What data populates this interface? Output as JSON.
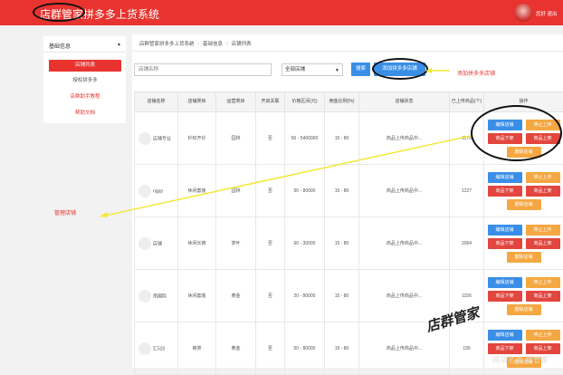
{
  "header": {
    "logo_text": "店群管家拼多多上货系统",
    "user_links": "您好 退出"
  },
  "sidebar": {
    "section_title": "基础信息",
    "collapse_icon": "triangle-up-icon",
    "items": [
      {
        "label": "店铺列表",
        "state": "active"
      },
      {
        "label": "授权拼多多",
        "state": "plain"
      },
      {
        "label": "店群助手教程",
        "state": "red"
      },
      {
        "label": "帮助文档",
        "state": "red"
      }
    ]
  },
  "breadcrumb": [
    "店群管家拼多多上货系统",
    "基础信息",
    "店铺列表"
  ],
  "toolbar": {
    "search_placeholder": "店铺名称",
    "select_value": "全部店铺",
    "search_label": "搜索",
    "add_label": "添加拼多多店铺"
  },
  "table": {
    "headers": [
      "店铺名称",
      "店铺类目",
      "运营类目",
      "开启关联",
      "价格区间(元)",
      "佣金比例(%)",
      "店铺状态",
      "已上传商品(个)",
      "操作"
    ],
    "rows": [
      {
        "name": "店铺专业",
        "category": "针织开衫",
        "op_category": "园林",
        "related": "否",
        "price": "50 - 5400000",
        "commission": "15 - 80",
        "status": "商品上传商品中...",
        "uploaded": "1175"
      },
      {
        "name": "ngpp",
        "category": "休闲套装",
        "op_category": "园林",
        "related": "否",
        "price": "50 - 80000",
        "commission": "15 - 80",
        "status": "商品上传商品中...",
        "uploaded": "1227"
      },
      {
        "name": "店铺",
        "category": "休闲长裤",
        "op_category": "茶叶",
        "related": "否",
        "price": "60 - 30000",
        "commission": "15 - 80",
        "status": "商品上传商品中...",
        "uploaded": "2064"
      },
      {
        "name": "南国际",
        "category": "休闲套装",
        "op_category": "黄金",
        "related": "否",
        "price": "20 - 80000",
        "commission": "15 - 80",
        "status": "商品上传商品中...",
        "uploaded": "1156"
      },
      {
        "name": "汇520",
        "category": "裤类",
        "op_category": "黄金",
        "related": "否",
        "price": "50 - 80000",
        "commission": "15 - 80",
        "status": "商品上传商品中...",
        "uploaded": "190"
      }
    ],
    "op_labels": {
      "edit": "编辑店铺",
      "stop_upload": "停止上传",
      "take_down": "商品下架",
      "put_up": "商品上架",
      "delete": "删除店铺"
    }
  },
  "annotations": {
    "add_shop": "添加拼多多店铺",
    "manage_shop": "管理店铺",
    "watermark": "店群管家",
    "footer_watermark": "网站名片 群管家"
  },
  "colors": {
    "brand_red": "#e8332f",
    "button_blue": "#3a8ee6",
    "button_orange": "#f5a741",
    "button_red": "#e2463e"
  }
}
